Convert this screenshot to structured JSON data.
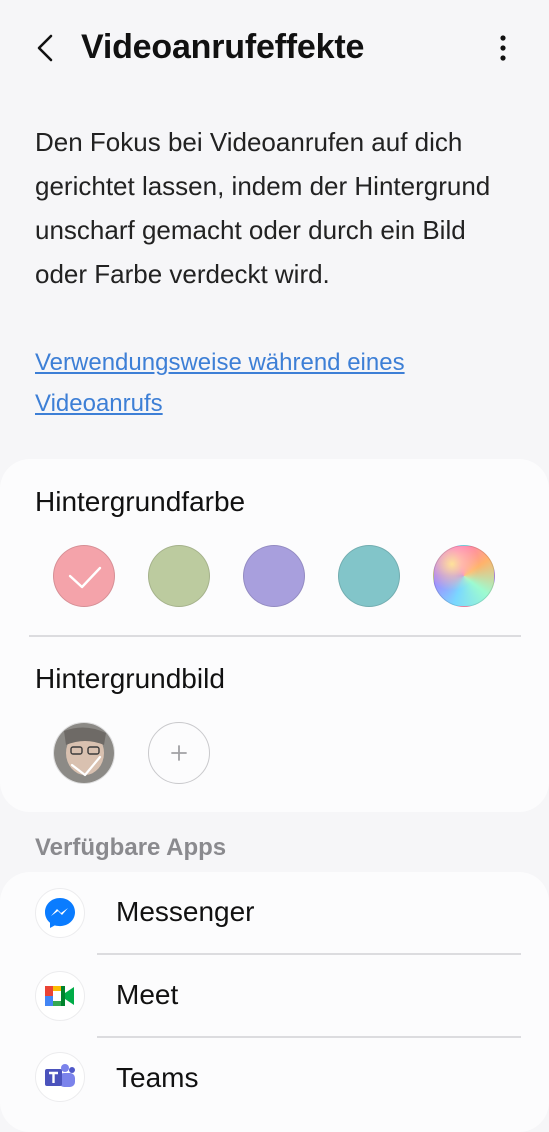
{
  "header": {
    "title": "Videoanrufeffekte",
    "back_icon": "chevron-left-icon",
    "more_icon": "more-vertical-icon"
  },
  "description": "Den Fokus bei Videoanrufen auf dich gerichtet lassen, indem der Hintergrund unscharf gemacht oder durch ein Bild oder Farbe verdeckt wird.",
  "help_link": "Verwendungsweise während eines Videoanrufs",
  "background_color": {
    "label": "Hintergrundfarbe",
    "selected_index": 0,
    "swatches": [
      {
        "color": "#f4a3aa",
        "selected": true
      },
      {
        "color": "#bccb9f",
        "selected": false
      },
      {
        "color": "#a89fdd",
        "selected": false
      },
      {
        "color": "#82c5c9",
        "selected": false
      },
      {
        "color": "gradient",
        "selected": false
      }
    ]
  },
  "background_image": {
    "label": "Hintergrundbild",
    "add_icon": "plus-icon"
  },
  "apps": {
    "section_label": "Verfügbare Apps",
    "items": [
      {
        "name": "Messenger",
        "icon": "messenger-icon"
      },
      {
        "name": "Meet",
        "icon": "meet-icon"
      },
      {
        "name": "Teams",
        "icon": "teams-icon"
      }
    ]
  },
  "colors": {
    "accent_link": "#3d7fd6",
    "background": "#f6f6f8",
    "card": "#fcfcfd"
  }
}
